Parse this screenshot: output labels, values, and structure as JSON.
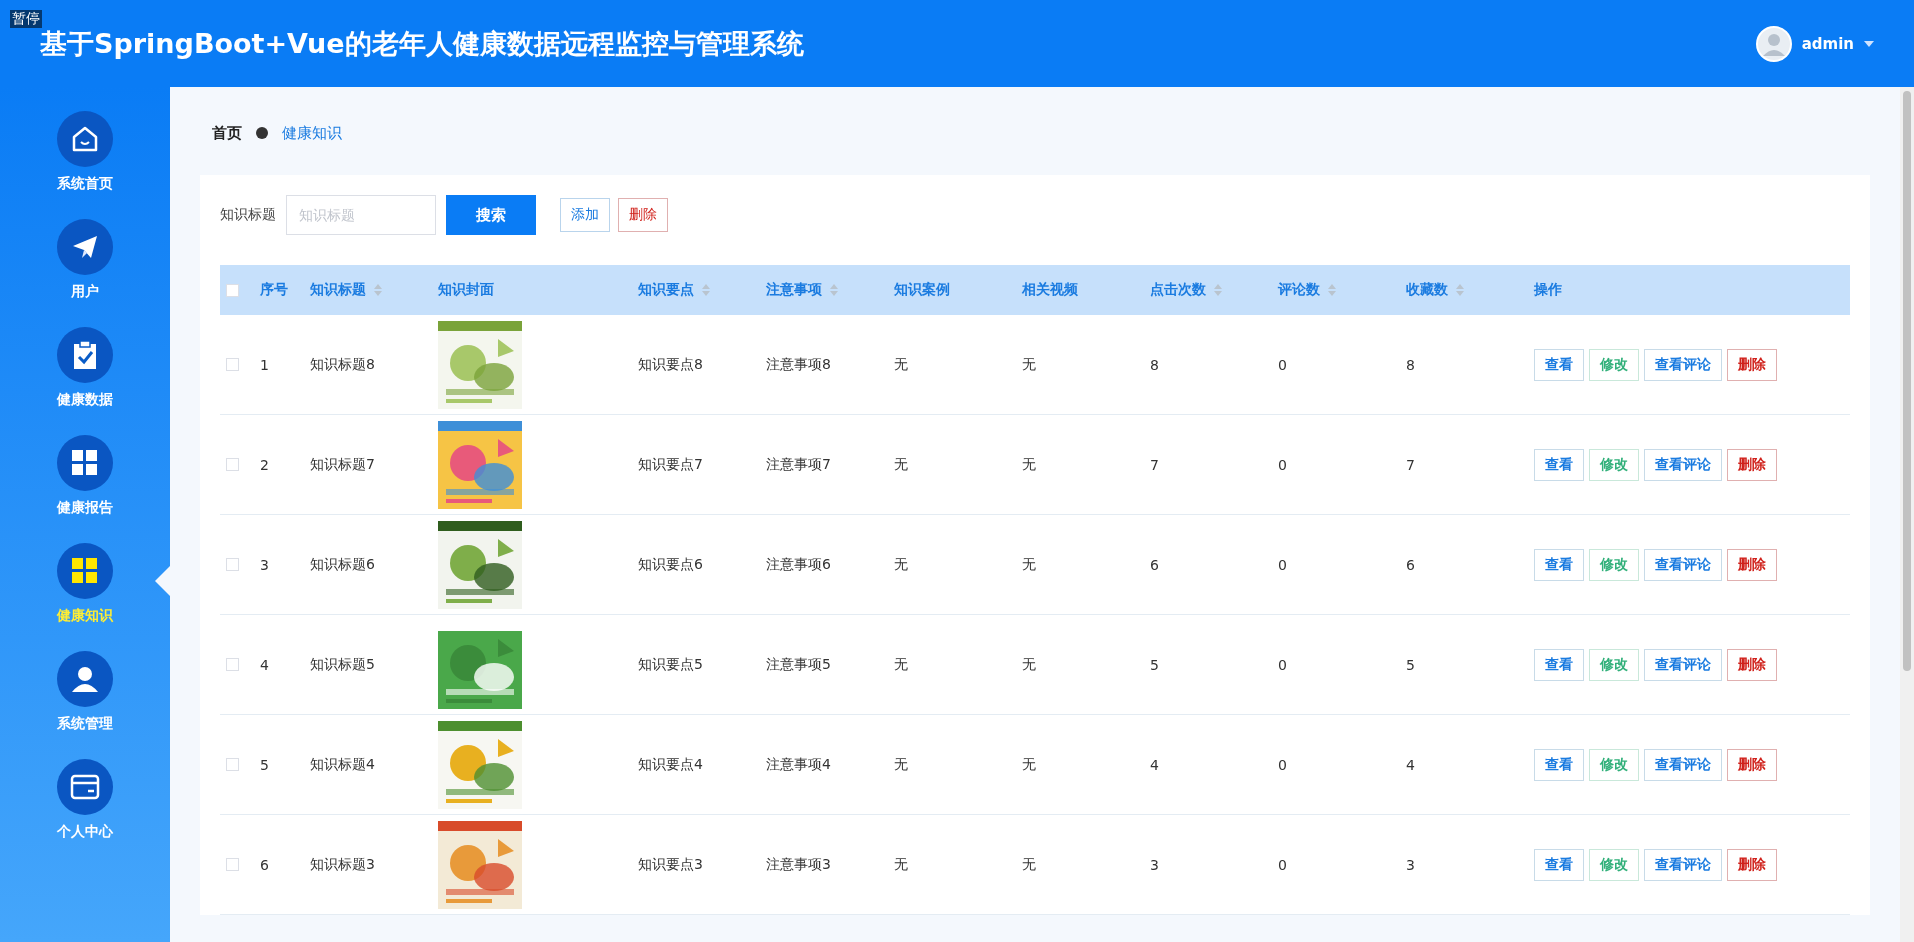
{
  "overlay_label": "暂停",
  "header": {
    "title": "基于SpringBoot+Vue的老年人健康数据远程监控与管理系统",
    "user": "admin"
  },
  "sidebar": {
    "items": [
      {
        "label": "系统首页",
        "selected": false
      },
      {
        "label": "用户",
        "selected": false
      },
      {
        "label": "健康数据",
        "selected": false
      },
      {
        "label": "健康报告",
        "selected": false
      },
      {
        "label": "健康知识",
        "selected": true
      },
      {
        "label": "系统管理",
        "selected": false
      },
      {
        "label": "个人中心",
        "selected": false
      }
    ]
  },
  "breadcrumb": [
    "首页",
    "健康知识"
  ],
  "search": {
    "label": "知识标题",
    "placeholder": "知识标题",
    "button": "搜索"
  },
  "actions": {
    "add": "添加",
    "delete": "删除"
  },
  "table": {
    "select_all_checked": false,
    "columns": [
      {
        "label": "序号",
        "sortable": false
      },
      {
        "label": "知识标题",
        "sortable": true
      },
      {
        "label": "知识封面",
        "sortable": false
      },
      {
        "label": "知识要点",
        "sortable": true
      },
      {
        "label": "注意事项",
        "sortable": true
      },
      {
        "label": "知识案例",
        "sortable": false
      },
      {
        "label": "相关视频",
        "sortable": false
      },
      {
        "label": "点击次数",
        "sortable": true
      },
      {
        "label": "评论数",
        "sortable": true
      },
      {
        "label": "收藏数",
        "sortable": true
      },
      {
        "label": "操作",
        "sortable": false
      }
    ],
    "rows": [
      {
        "checked": false,
        "cells": [
          "1",
          "知识标题8",
          "",
          "知识要点8",
          "注意事项8",
          "无",
          "无",
          "8",
          "0",
          "8"
        ],
        "buttons": [
          "查看",
          "修改",
          "查看评论",
          "删除"
        ]
      },
      {
        "checked": false,
        "cells": [
          "2",
          "知识标题7",
          "",
          "知识要点7",
          "注意事项7",
          "无",
          "无",
          "7",
          "0",
          "7"
        ],
        "buttons": [
          "查看",
          "修改",
          "查看评论",
          "删除"
        ]
      },
      {
        "checked": false,
        "cells": [
          "3",
          "知识标题6",
          "",
          "知识要点6",
          "注意事项6",
          "无",
          "无",
          "6",
          "0",
          "6"
        ],
        "buttons": [
          "查看",
          "修改",
          "查看评论",
          "删除"
        ]
      },
      {
        "checked": false,
        "cells": [
          "4",
          "知识标题5",
          "",
          "知识要点5",
          "注意事项5",
          "无",
          "无",
          "5",
          "0",
          "5"
        ],
        "buttons": [
          "查看",
          "修改",
          "查看评论",
          "删除"
        ]
      },
      {
        "checked": false,
        "cells": [
          "5",
          "知识标题4",
          "",
          "知识要点4",
          "注意事项4",
          "无",
          "无",
          "4",
          "0",
          "4"
        ],
        "buttons": [
          "查看",
          "修改",
          "查看评论",
          "删除"
        ]
      },
      {
        "checked": false,
        "cells": [
          "6",
          "知识标题3",
          "",
          "知识要点3",
          "注意事项3",
          "无",
          "无",
          "3",
          "0",
          "3"
        ],
        "buttons": [
          "查看",
          "修改",
          "查看评论",
          "删除"
        ]
      }
    ]
  }
}
